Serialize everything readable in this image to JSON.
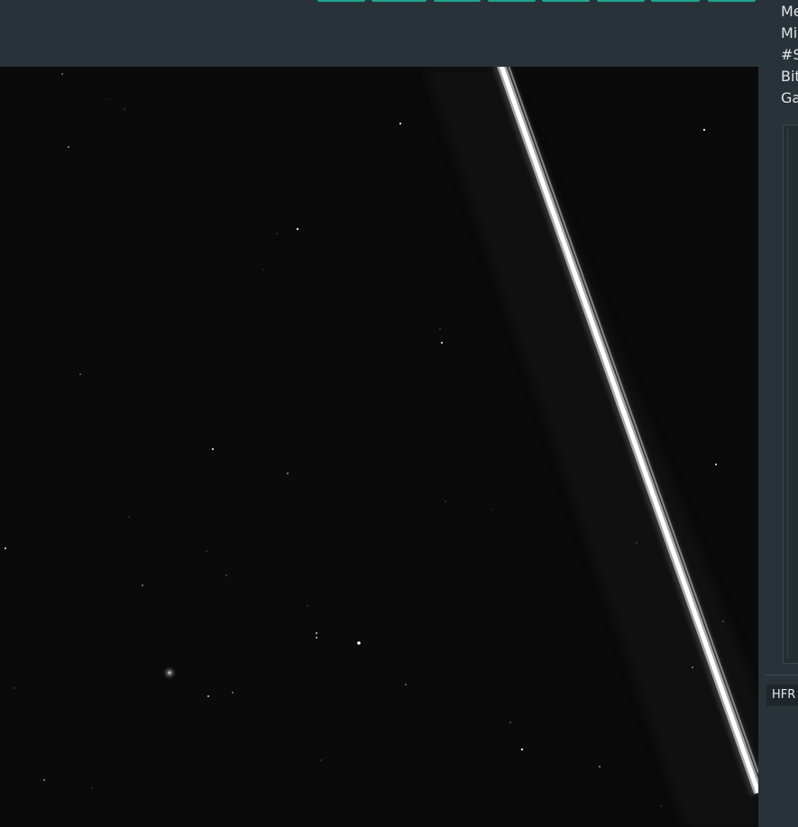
{
  "right_panel": {
    "stats": [
      {
        "label": "Me"
      },
      {
        "label": "Mi"
      },
      {
        "label": "#S"
      },
      {
        "label": "Bit"
      },
      {
        "label": "Ga"
      }
    ],
    "hfr_tab_label": "HFR"
  },
  "colors": {
    "toolbar_bg": "#283238",
    "accent": "#1fa58f",
    "viewer_bg": "#0a0a0a",
    "text": "#dfe4e6"
  }
}
